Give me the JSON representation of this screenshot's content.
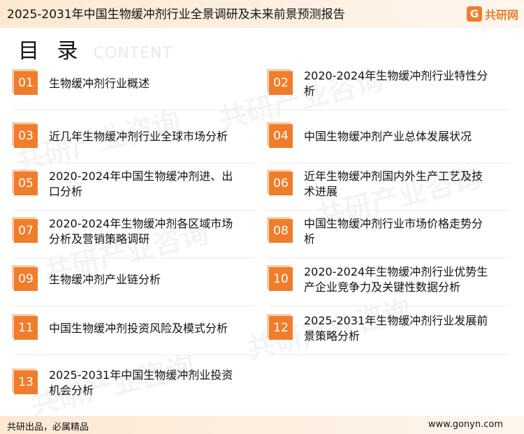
{
  "header": {
    "title": "2025-2031年中国生物缓冲剂行业全景调研及未来前景预测报告",
    "logo_mark": "G",
    "logo_text": "共研网"
  },
  "toc": {
    "title": "目 录",
    "subtitle": "CONTENT"
  },
  "entries": [
    {
      "num": "01",
      "text": "生物缓冲剂行业概述"
    },
    {
      "num": "02",
      "text": "2020-2024年生物缓冲剂行业特性分析"
    },
    {
      "num": "03",
      "text": "近几年生物缓冲剂行业全球市场分析"
    },
    {
      "num": "04",
      "text": "中国生物缓冲剂产业总体发展状况"
    },
    {
      "num": "05",
      "text": "2020-2024年中国生物缓冲剂进、出口分析"
    },
    {
      "num": "06",
      "text": "近年生物缓冲剂国内外生产工艺及技术进展"
    },
    {
      "num": "07",
      "text": "2020-2024年生物缓冲剂各区域市场分析及营销策略调研"
    },
    {
      "num": "08",
      "text": "中国生物缓冲剂行业市场价格走势分析"
    },
    {
      "num": "09",
      "text": "生物缓冲剂产业链分析"
    },
    {
      "num": "10",
      "text": "2020-2024年生物缓冲剂行业优势生产企业竞争力及关键性数据分析"
    },
    {
      "num": "11",
      "text": "中国生物缓冲剂投资风险及模式分析"
    },
    {
      "num": "12",
      "text": "2025-2031年生物缓冲剂行业发展前景策略分析"
    },
    {
      "num": "13",
      "text": "2025-2031年中国生物缓冲剂业投资机会分析"
    }
  ],
  "watermark": {
    "text": "共研产业咨询",
    "url": "gonyn.com"
  },
  "footer": {
    "left": "共研出品，必属精品",
    "right": "www.gonyn.com"
  }
}
